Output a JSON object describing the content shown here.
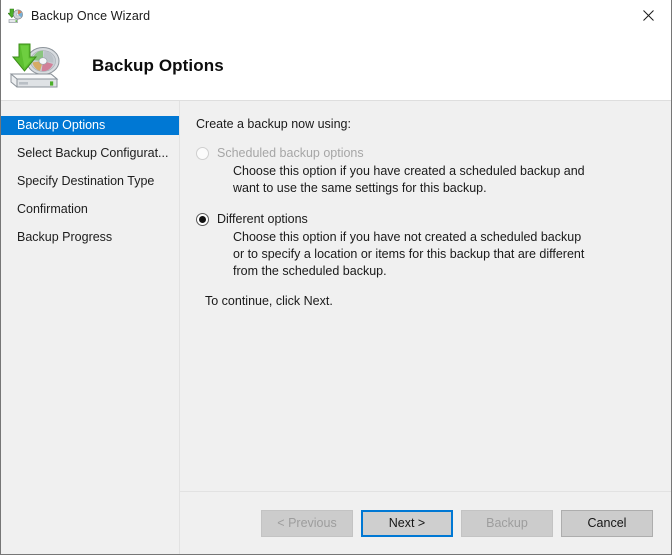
{
  "window": {
    "title": "Backup Once Wizard",
    "title_icon": "backup-wizard-icon",
    "close_icon": "close-icon"
  },
  "header": {
    "title": "Backup Options",
    "icon": "backup-disk-icon"
  },
  "sidebar": {
    "items": [
      {
        "label": "Backup Options",
        "active": true
      },
      {
        "label": "Select Backup Configurat...",
        "active": false
      },
      {
        "label": "Specify Destination Type",
        "active": false
      },
      {
        "label": "Confirmation",
        "active": false
      },
      {
        "label": "Backup Progress",
        "active": false
      }
    ]
  },
  "content": {
    "prompt": "Create a backup now using:",
    "options": [
      {
        "label": "Scheduled backup options",
        "selected": false,
        "disabled": true,
        "description": "Choose this option if you have created a scheduled backup and want to use the same settings for this backup."
      },
      {
        "label": "Different options",
        "selected": true,
        "disabled": false,
        "description": "Choose this option if you have not created a scheduled backup or to specify a location or items for this backup that are different from the scheduled backup."
      }
    ],
    "continue_text": "To continue, click Next."
  },
  "footer": {
    "buttons": [
      {
        "label": "< Previous",
        "disabled": true,
        "focused": false
      },
      {
        "label": "Next >",
        "disabled": false,
        "focused": true
      },
      {
        "label": "Backup",
        "disabled": true,
        "focused": false
      },
      {
        "label": "Cancel",
        "disabled": false,
        "focused": false
      }
    ]
  },
  "colors": {
    "accent": "#0078d4",
    "sidebar_bg": "#f0f0f0",
    "content_bg": "#f0f0f0",
    "button_bg": "#cccccc",
    "text": "#1a1a1a",
    "disabled_text": "#a6a6a6"
  }
}
